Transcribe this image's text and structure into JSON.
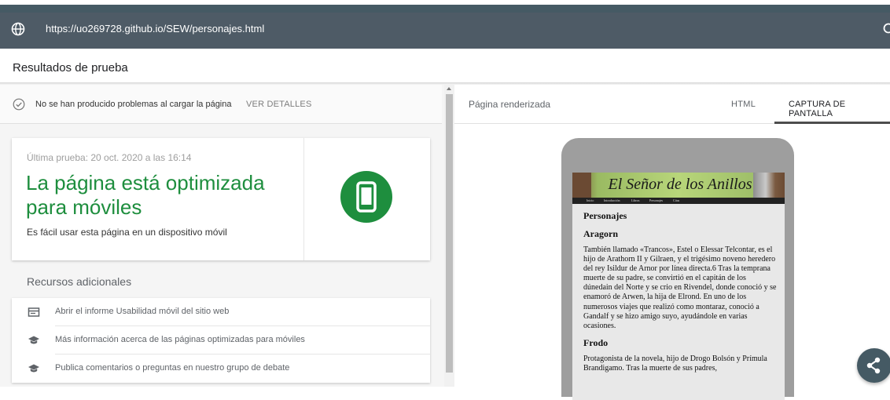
{
  "browser": {
    "url": "https://uo269728.github.io/SEW/personajes.html",
    "globe_icon": "globe-icon",
    "search_icon": "search-icon"
  },
  "results": {
    "title": "Resultados de prueba"
  },
  "status": {
    "message": "No se han producido problemas al cargar la página",
    "details_link": "VER DETALLES",
    "icon": "check-circle-icon"
  },
  "summary_card": {
    "last_test": "Última prueba: 20 oct. 2020 a las 16:14",
    "headline": "La página está optimizada para móviles",
    "subline": "Es fácil usar esta página en un dispositivo móvil",
    "icon": "mobile-phone-icon",
    "accent_color": "#1e8e3e"
  },
  "resources": {
    "title": "Recursos adicionales",
    "items": [
      {
        "label": "Abrir el informe Usabilidad móvil del sitio web",
        "icon": "report-icon"
      },
      {
        "label": "Más información acerca de las páginas optimizadas para móviles",
        "icon": "school-icon"
      },
      {
        "label": "Publica comentarios o preguntas en nuestro grupo de debate",
        "icon": "school-icon"
      }
    ]
  },
  "right_panel": {
    "label": "Página renderizada",
    "tabs": [
      {
        "label": "HTML",
        "active": false
      },
      {
        "label": "CAPTURA DE PANTALLA",
        "active": true
      }
    ]
  },
  "rendered_page": {
    "banner_title": "El Señor de los Anillos",
    "nav_items": [
      "Inicio",
      "Introducción",
      "Libros",
      "Personajes",
      "Citas"
    ],
    "heading": "Personajes",
    "sections": [
      {
        "name": "Aragorn",
        "text": "También llamado «Trancos», Estel o Elessar Telcontar, es el hijo de Arathorn II y Gilraen, y el trigésimo noveno heredero del rey Isildur de Arnor por línea directa.6 Tras la temprana muerte de su padre, se convirtió en el capitán de los dúnedain del Norte y se crio en Rivendel, donde conoció y se enamoró de Arwen, la hija de Elrond. En uno de los numerosos viajes que realizó como montaraz, conoció a Gandalf y se hizo amigo suyo, ayudándole en varias ocasiones."
      },
      {
        "name": "Frodo",
        "text": "Protagonista de la novela, hijo de Drogo Bolsón y Prímula Brandigamo. Tras la muerte de sus padres,"
      }
    ]
  },
  "share_button": {
    "icon": "share-icon"
  }
}
